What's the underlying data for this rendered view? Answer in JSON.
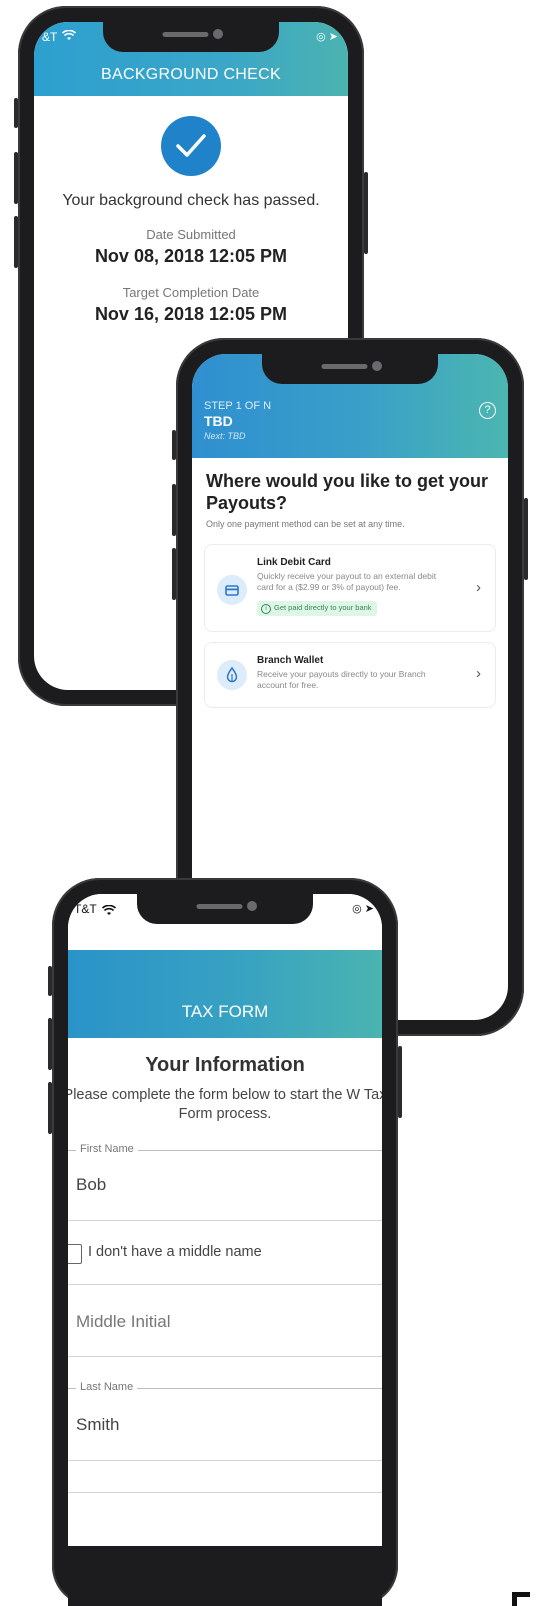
{
  "phone1": {
    "status_left": "&T",
    "header_title": "BACKGROUND CHECK",
    "message": "Your background check has passed.",
    "date_submitted_label": "Date Submitted",
    "date_submitted_value": "Nov 08, 2018 12:05 PM",
    "target_label": "Target Completion Date",
    "target_value": "Nov 16, 2018 12:05 PM"
  },
  "phone2": {
    "step_label": "STEP 1 OF N",
    "step_title": "TBD",
    "next_label": "Next: TBD",
    "heading": "Where would you like to get your Payouts?",
    "subtext": "Only one payment method can be set at any time.",
    "options": [
      {
        "title": "Link Debit Card",
        "desc": "Quickly receive your payout to an external debit card for a ($2.99 or 3% of payout) fee.",
        "badge": "Get paid directly to your bank",
        "icon": "card-icon"
      },
      {
        "title": "Branch Wallet",
        "desc": "Receive your payouts directly to your Branch account for free.",
        "icon": "wallet-drop-icon"
      }
    ]
  },
  "phone3": {
    "status_left": "T&T",
    "header_title": "TAX FORM",
    "heading": "Your Information",
    "instructions": "Please complete the form below to start the W Tax Form process.",
    "first_name_label": "First Name",
    "first_name_value": "Bob",
    "no_middle_label": "I don't have a middle name",
    "middle_placeholder": "Middle Initial",
    "last_name_label": "Last Name",
    "last_name_value": "Smith"
  },
  "colors": {
    "header_blue": "#2da0cf",
    "header_teal": "#4bb3b0",
    "check_blue": "#2083c9",
    "badge_green": "#dff5e8"
  }
}
